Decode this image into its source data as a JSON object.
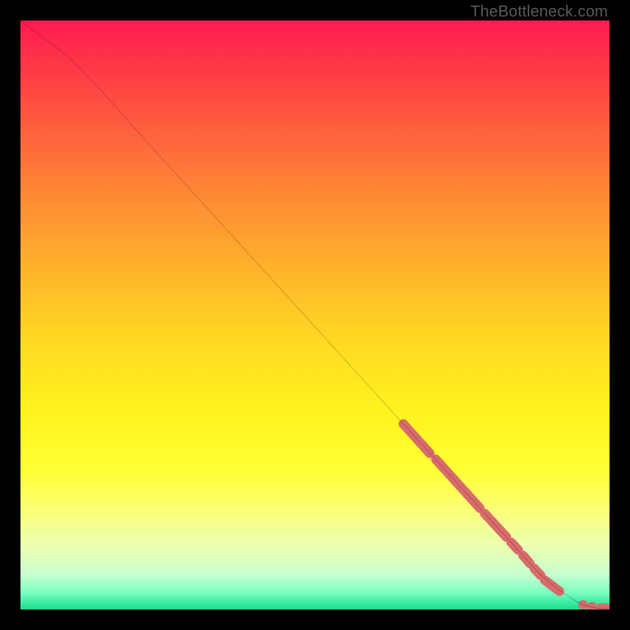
{
  "watermark": "TheBottleneck.com",
  "chart_data": {
    "type": "line",
    "title": "",
    "xlabel": "",
    "ylabel": "",
    "xlim": [
      0,
      100
    ],
    "ylim": [
      0,
      100
    ],
    "grid": false,
    "legend": false,
    "curve": {
      "x": [
        0,
        4,
        8,
        12,
        20,
        30,
        40,
        50,
        60,
        65,
        70,
        75,
        80,
        85,
        88,
        91,
        94,
        96,
        98,
        100
      ],
      "y": [
        100,
        97,
        94,
        90,
        81,
        70,
        59,
        48,
        37,
        31.5,
        26,
        20.5,
        15,
        9.5,
        6.2,
        3.6,
        1.6,
        0.6,
        0.2,
        0.1
      ]
    },
    "markers": [
      {
        "type": "segment",
        "x0": 65.0,
        "y0": 31.5,
        "x1": 69.5,
        "y1": 26.5
      },
      {
        "type": "segment",
        "x0": 70.5,
        "y0": 25.5,
        "x1": 78.0,
        "y1": 17.2
      },
      {
        "type": "segment",
        "x0": 78.8,
        "y0": 16.3,
        "x1": 82.5,
        "y1": 12.3
      },
      {
        "type": "segment",
        "x0": 83.3,
        "y0": 11.4,
        "x1": 84.5,
        "y1": 10.1
      },
      {
        "type": "segment",
        "x0": 85.3,
        "y0": 9.2,
        "x1": 86.5,
        "y1": 7.8
      },
      {
        "type": "segment",
        "x0": 87.2,
        "y0": 7.0,
        "x1": 88.3,
        "y1": 5.8
      },
      {
        "type": "segment",
        "x0": 89.0,
        "y0": 5.0,
        "x1": 91.5,
        "y1": 3.1
      },
      {
        "type": "dot",
        "x": 95.5,
        "y": 0.8
      },
      {
        "type": "dot",
        "x": 97.0,
        "y": 0.5
      },
      {
        "type": "segment",
        "x0": 98.5,
        "y0": 0.25,
        "x1": 100.0,
        "y1": 0.15
      }
    ],
    "marker_style": {
      "color": "#d86b6b",
      "width": 12,
      "cap": "round"
    },
    "line_style": {
      "color": "#000000",
      "width": 2
    }
  }
}
